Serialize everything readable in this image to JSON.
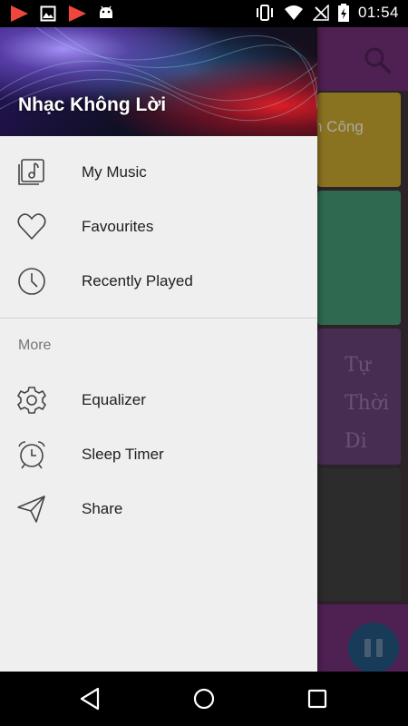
{
  "status_bar": {
    "time": "01:54",
    "left_icons": [
      "youtube-icon",
      "image-icon",
      "youtube-icon",
      "android-icon"
    ],
    "right_icons": [
      "vibrate-icon",
      "wifi-icon",
      "no-signal-icon",
      "battery-charging-icon"
    ]
  },
  "drawer": {
    "title": "Nhạc Không Lời",
    "primary_items": [
      {
        "label": "My Music",
        "icon": "music-library-icon"
      },
      {
        "label": "Favourites",
        "icon": "heart-icon"
      },
      {
        "label": "Recently Played",
        "icon": "clock-icon"
      }
    ],
    "section_title": "More",
    "secondary_items": [
      {
        "label": "Equalizer",
        "icon": "gear-icon"
      },
      {
        "label": "Sleep Timer",
        "icon": "alarm-clock-icon"
      },
      {
        "label": "Share",
        "icon": "send-icon"
      }
    ]
  },
  "background": {
    "card_fragment": "n Công",
    "card3_script": "Tự\nThời\nDi"
  },
  "colors": {
    "toolbar": "#6a2b6e",
    "drawer_bg": "#efefef",
    "fab": "#1f4f76"
  }
}
